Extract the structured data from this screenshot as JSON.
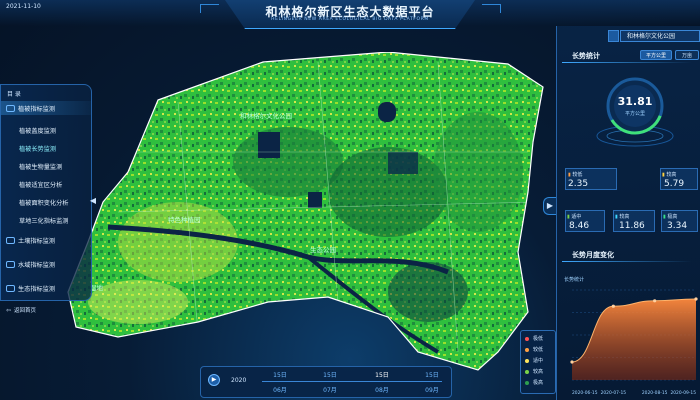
{
  "header": {
    "date": "2021-11-10",
    "title": "和林格尔新区生态大数据平台",
    "subtitle": "HELINGEER NEW AREA ECOLOGICAL BIG DATA PLATFORM"
  },
  "nav": {
    "title": "目 录",
    "items": [
      {
        "label": "植被指标监测",
        "icon": "leaf-icon",
        "type": "group"
      },
      {
        "label": "植被盖度监测",
        "type": "sub"
      },
      {
        "label": "植被长势监测",
        "type": "sub",
        "active": true
      },
      {
        "label": "植被生物量监测",
        "type": "sub"
      },
      {
        "label": "植被适宜区分析",
        "type": "sub"
      },
      {
        "label": "植被面积变化分析",
        "type": "sub"
      },
      {
        "label": "草地三化指标监测",
        "type": "sub"
      },
      {
        "label": "土壤指标监测",
        "icon": "soil-icon",
        "type": "group"
      },
      {
        "label": "水域指标监测",
        "icon": "water-icon",
        "type": "group"
      },
      {
        "label": "生态指标监测",
        "icon": "eco-icon",
        "type": "group"
      }
    ],
    "back_label": "返回首页"
  },
  "right_panel": {
    "park_name": "和林格尔文化公园",
    "growth_stats": {
      "title": "长势统计",
      "tabs": [
        "平方公里",
        "万亩"
      ],
      "gauge_value": "31.81",
      "gauge_unit": "平方公里",
      "boxes": [
        {
          "label": "较低",
          "value": "2.35",
          "color": "#ff9f43"
        },
        {
          "label": "较高",
          "value": "5.79",
          "color": "#ffd23f"
        },
        {
          "label": "适中",
          "value": "8.46",
          "color": "#7bd348"
        },
        {
          "label": "较高",
          "value": "11.86",
          "color": "#3fd6ff"
        },
        {
          "label": "极高",
          "value": "3.34",
          "color": "#38e08a"
        }
      ]
    },
    "monthly_change": {
      "title": "长势月度变化",
      "series_label": "长势统计"
    }
  },
  "legend": {
    "items": [
      {
        "label": "极低",
        "color": "#ff5252"
      },
      {
        "label": "较低",
        "color": "#ff9f43"
      },
      {
        "label": "适中",
        "color": "#ffe45c"
      },
      {
        "label": "较高",
        "color": "#7bd348"
      },
      {
        "label": "极高",
        "color": "#2e9e4f"
      }
    ]
  },
  "timeline": {
    "year": "2020",
    "days": [
      "15日",
      "15日",
      "15日",
      "15日"
    ],
    "months": [
      "06月",
      "07月",
      "08月",
      "09月"
    ],
    "current_index": 2
  },
  "map": {
    "labels": [
      "特色种植园",
      "生态公园",
      "湿地",
      "和林格尔文化公园"
    ]
  },
  "chart_data": {
    "type": "area",
    "title": "长势月度变化",
    "ylabel": "长势统计",
    "x": [
      "2020-06-15",
      "2020-07-15",
      "2020-08-15",
      "2020-09-15"
    ],
    "series": [
      {
        "name": "长势统计",
        "values": [
          0.2,
          0.82,
          0.88,
          0.9
        ]
      }
    ],
    "ylim": [
      0,
      1
    ],
    "colors": {
      "area_top": "#ff8a3d",
      "area_bottom": "#8a2a10",
      "line": "#ffb36b"
    }
  }
}
